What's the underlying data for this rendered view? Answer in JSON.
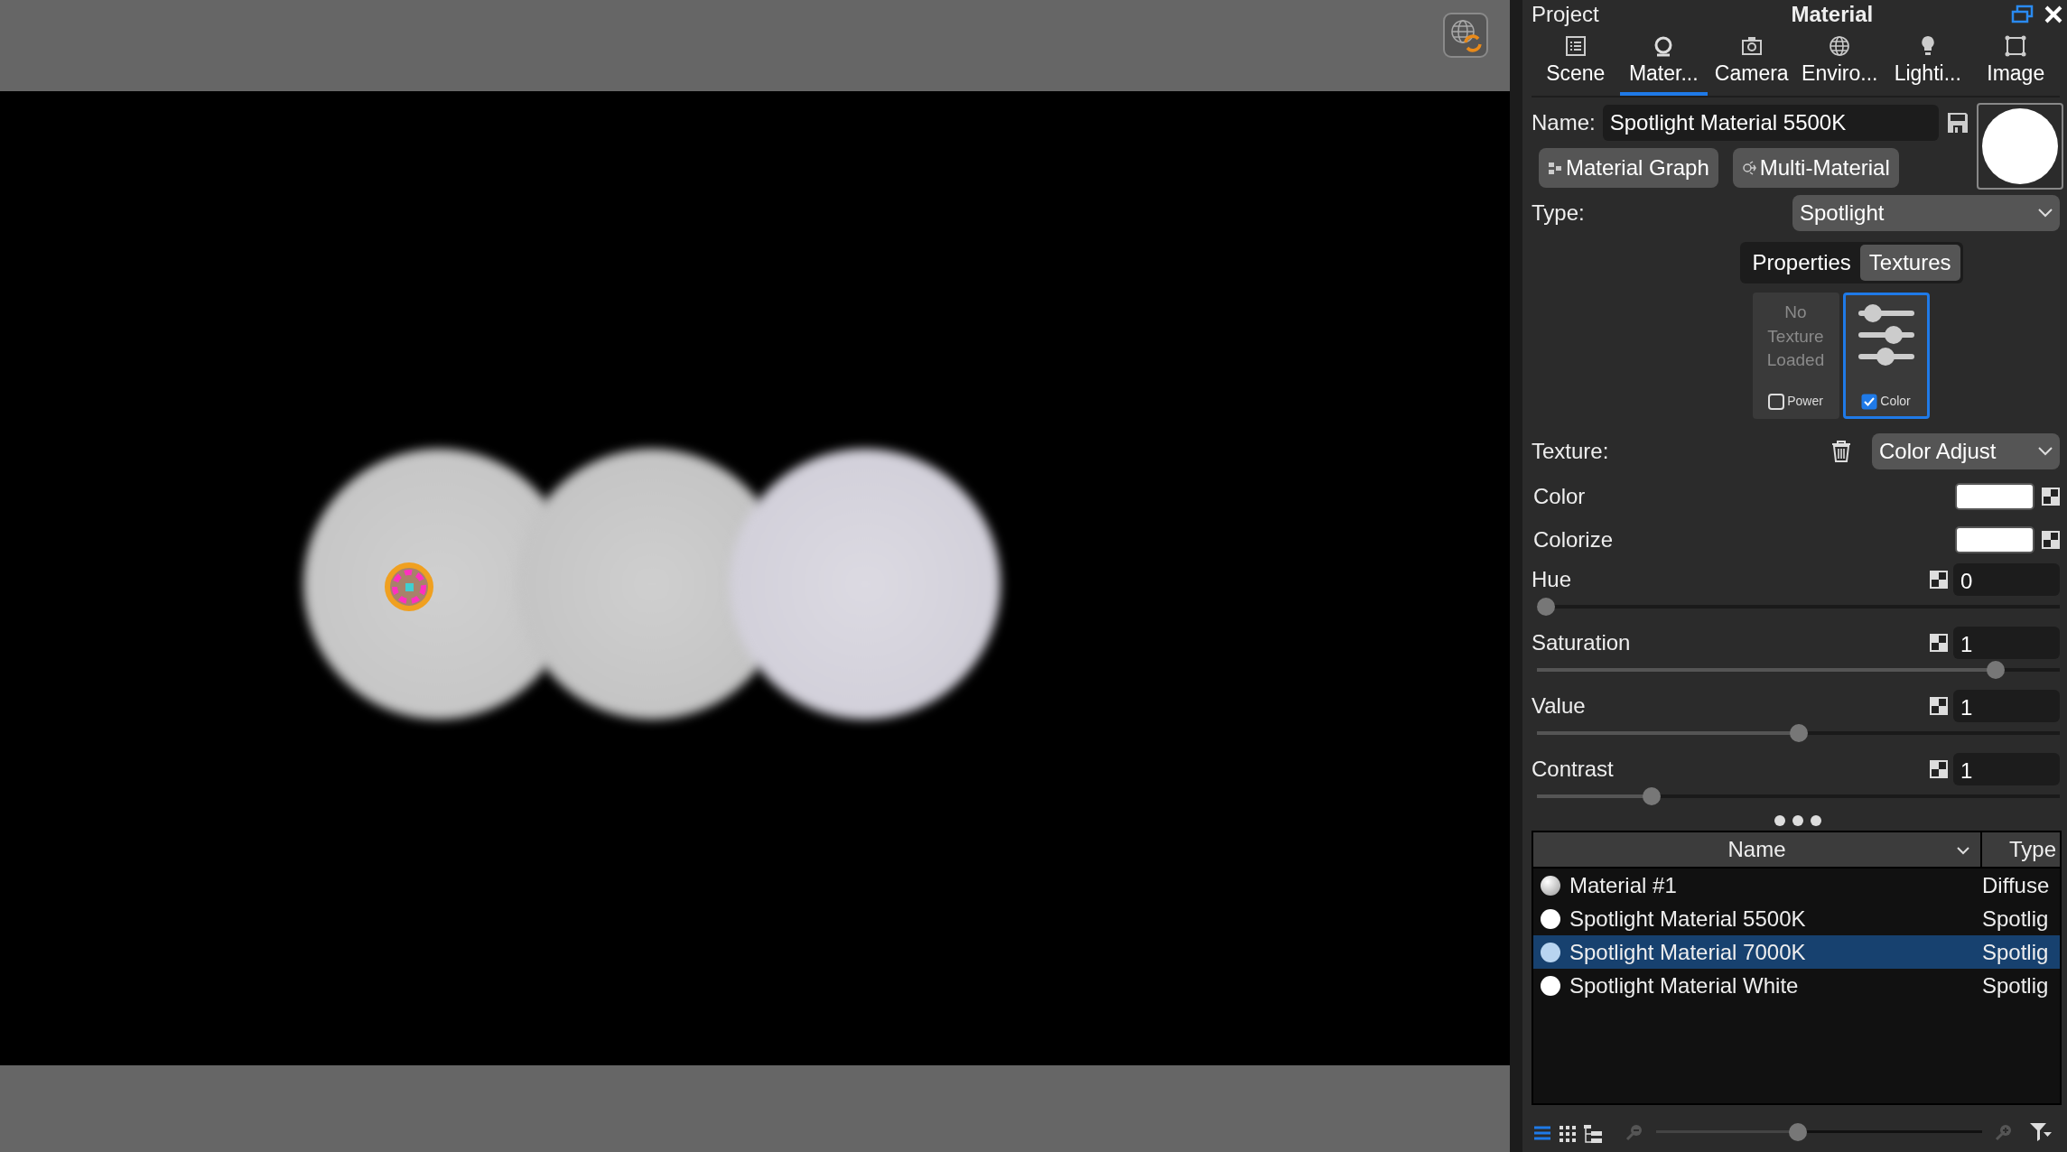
{
  "header": {
    "left": "Project",
    "title": "Material"
  },
  "tabs": [
    {
      "label": "Scene",
      "selected": false
    },
    {
      "label": "Mater...",
      "selected": true
    },
    {
      "label": "Camera",
      "selected": false
    },
    {
      "label": "Enviro...",
      "selected": false
    },
    {
      "label": "Lighti...",
      "selected": false
    },
    {
      "label": "Image",
      "selected": false
    }
  ],
  "name_field": {
    "label": "Name:",
    "value": "Spotlight Material 5500K"
  },
  "buttons": [
    "Material Graph",
    "Multi-Material"
  ],
  "type": {
    "label": "Type:",
    "value": "Spotlight"
  },
  "segments": [
    {
      "label": "Properties",
      "selected": false
    },
    {
      "label": "Textures",
      "selected": true
    }
  ],
  "texture_slots": [
    {
      "kind": "empty",
      "text": "No Texture Loaded",
      "label": "Power",
      "checked": false,
      "selected": false
    },
    {
      "kind": "adjust",
      "label": "Color",
      "checked": true,
      "selected": true
    }
  ],
  "texture": {
    "label": "Texture:",
    "value": "Color Adjust"
  },
  "color_rows": [
    "Color",
    "Colorize"
  ],
  "sliders": [
    {
      "label": "Hue",
      "value": "0",
      "level": 0
    },
    {
      "label": "Saturation",
      "value": "1",
      "level": 0.89
    },
    {
      "label": "Value",
      "value": "1",
      "level": 0.5
    },
    {
      "label": "Contrast",
      "value": "1",
      "level": 0.21
    }
  ],
  "table": {
    "columns": [
      "Name",
      "Type"
    ],
    "rows": [
      {
        "name": "Material #1",
        "type": "Diffuse",
        "selected": false
      },
      {
        "name": "Spotlight Material 5500K",
        "type": "Spotlig",
        "selected": false
      },
      {
        "name": "Spotlight Material 7000K",
        "type": "Spotlig",
        "selected": true
      },
      {
        "name": "Spotlight Material White",
        "type": "Spotlig",
        "selected": false
      }
    ]
  },
  "view_buttons": [
    {
      "selected": true
    },
    {
      "selected": false
    },
    {
      "selected": false
    }
  ],
  "zoom_slider": {
    "level": 0.43
  }
}
